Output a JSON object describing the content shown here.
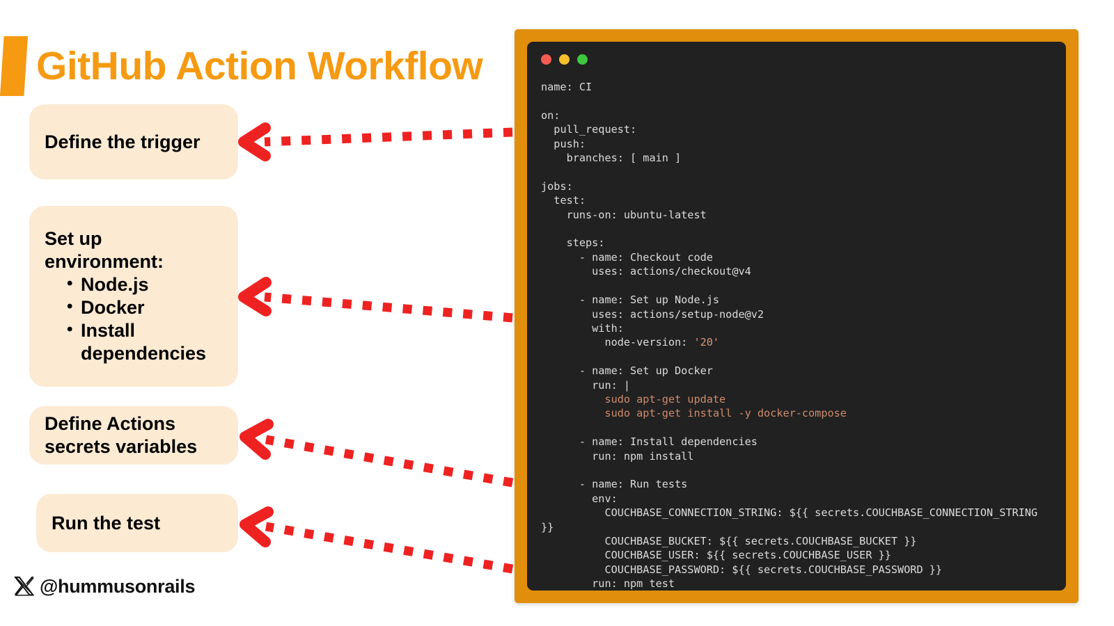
{
  "slide": {
    "title": "GitHub Action Workflow",
    "accent_color": "#f59a11",
    "background_color": "#ffffff"
  },
  "steps": [
    {
      "id": "define-the-trigger",
      "title": "Define the trigger",
      "bullets": []
    },
    {
      "id": "set-up-environment",
      "title": "Set up environment:",
      "bullets": [
        "Node.js",
        "Docker",
        "Install dependencies"
      ]
    },
    {
      "id": "define-actions-secrets-variables",
      "title": "Define Actions secrets variables",
      "bullets": []
    },
    {
      "id": "run-the-test",
      "title": "Run the test",
      "bullets": []
    }
  ],
  "arrows": {
    "color": "#ef2222",
    "count": 4,
    "style": "dashed-with-chevron-head"
  },
  "handle": {
    "icon": "x-logo-icon",
    "text": "@hummusonrails"
  },
  "terminal": {
    "frame_color": "#e08e0b",
    "window_color": "#212121",
    "dots": [
      {
        "name": "close",
        "color": "#f45b52"
      },
      {
        "name": "minimize",
        "color": "#f5bf2e"
      },
      {
        "name": "maximize",
        "color": "#3dc83d"
      }
    ],
    "language": "yaml",
    "filename_hint": "CI workflow",
    "code_lines": [
      "name: CI",
      "",
      "on:",
      "  pull_request:",
      "  push:",
      "    branches: [ main ]",
      "",
      "jobs:",
      "  test:",
      "    runs-on: ubuntu-latest",
      "",
      "    steps:",
      "      - name: Checkout code",
      "        uses: actions/checkout@v4",
      "",
      "      - name: Set up Node.js",
      "        uses: actions/setup-node@v2",
      "        with:",
      "          node-version: '20'",
      "",
      "      - name: Set up Docker",
      "        run: |",
      "          sudo apt-get update",
      "          sudo apt-get install -y docker-compose",
      "",
      "      - name: Install dependencies",
      "        run: npm install",
      "",
      "      - name: Run tests",
      "        env:",
      "          COUCHBASE_CONNECTION_STRING: ${{ secrets.COUCHBASE_CONNECTION_STRING }}",
      "          COUCHBASE_BUCKET: ${{ secrets.COUCHBASE_BUCKET }}",
      "          COUCHBASE_USER: ${{ secrets.COUCHBASE_USER }}",
      "          COUCHBASE_PASSWORD: ${{ secrets.COUCHBASE_PASSWORD }}",
      "        run: npm test"
    ],
    "highlighted_tokens": [
      {
        "token": "'20'",
        "color": "#d8977c",
        "role": "string"
      },
      {
        "token": "sudo apt-get update",
        "color": "#cf8b6d",
        "role": "shell-command"
      },
      {
        "token": "sudo apt-get install -y docker-compose",
        "color": "#cf8b6d",
        "role": "shell-command"
      }
    ]
  }
}
